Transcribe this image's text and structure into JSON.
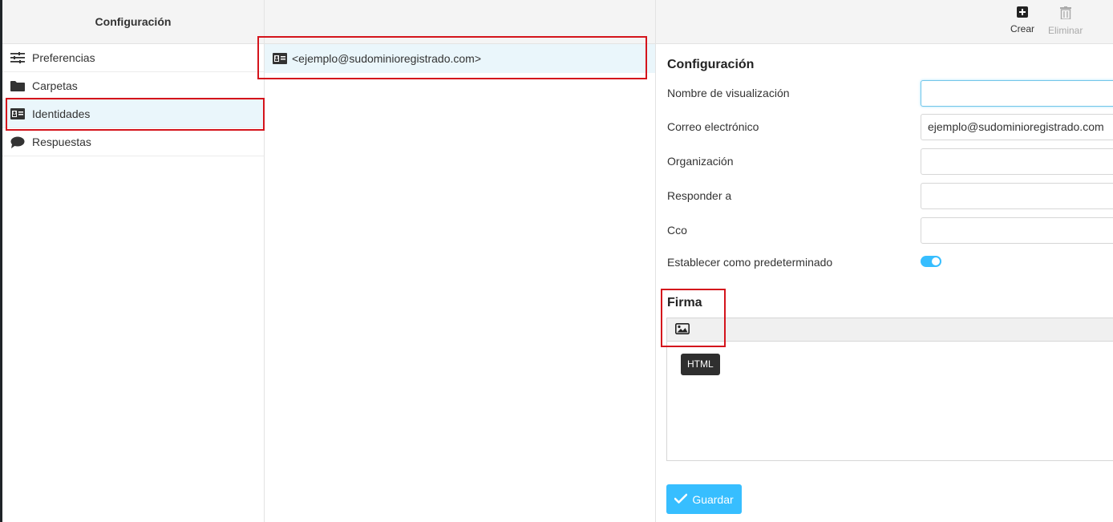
{
  "sidebar": {
    "title": "Configuración",
    "items": [
      {
        "label": "Preferencias",
        "icon": "sliders-icon"
      },
      {
        "label": "Carpetas",
        "icon": "folder-icon"
      },
      {
        "label": "Identidades",
        "icon": "id-card-icon",
        "selected": true
      },
      {
        "label": "Respuestas",
        "icon": "comment-icon"
      }
    ]
  },
  "identities": {
    "items": [
      {
        "label": "<ejemplo@sudominioregistrado.com>",
        "icon": "id-card-icon"
      }
    ]
  },
  "toolbar": {
    "create_label": "Crear",
    "delete_label": "Eliminar"
  },
  "form": {
    "section_title": "Configuración",
    "display_name_label": "Nombre de visualización",
    "display_name_value": "",
    "email_label": "Correo electrónico",
    "email_value": "ejemplo@sudominioregistrado.com",
    "organization_label": "Organización",
    "organization_value": "",
    "reply_to_label": "Responder a",
    "reply_to_value": "",
    "bcc_label": "Cco",
    "bcc_value": "",
    "default_label": "Establecer como predeterminado",
    "default_on": true
  },
  "signature": {
    "title": "Firma",
    "tooltip": "HTML"
  },
  "save_label": "Guardar",
  "colors": {
    "accent": "#37beff",
    "highlight": "#d4141c",
    "selected_row": "#eaf6fb"
  }
}
